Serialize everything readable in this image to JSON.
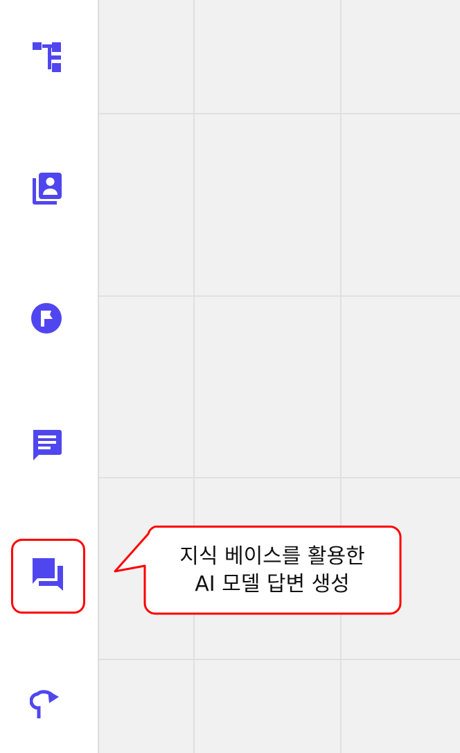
{
  "theme": {
    "icon_color": "#5046ef",
    "highlight_color": "#ff0000",
    "canvas_bg": "#f1f1f1",
    "grid_color": "#e0e0e0"
  },
  "sidebar": {
    "items": [
      {
        "icon": "hierarchy-icon",
        "name": "node-flow"
      },
      {
        "icon": "contact-book-icon",
        "name": "node-persona"
      },
      {
        "icon": "flag-circle-icon",
        "name": "node-start"
      },
      {
        "icon": "message-icon",
        "name": "node-message"
      },
      {
        "icon": "chat-bubbles-icon",
        "name": "node-ai-answer",
        "highlighted": true
      },
      {
        "icon": "redirect-arrow-icon",
        "name": "node-redirect"
      }
    ]
  },
  "callout": {
    "line1": "지식 베이스를 활용한",
    "line2": "AI 모델 답변 생성"
  }
}
